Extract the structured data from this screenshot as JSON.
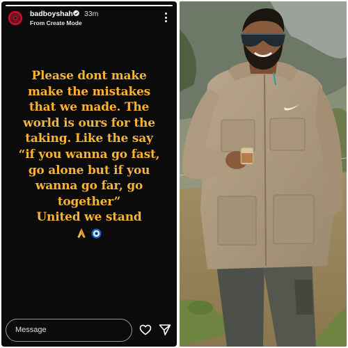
{
  "story": {
    "username": "badboyshah",
    "time_ago": "33m",
    "subtext": "From Create Mode",
    "progress": 1.0,
    "text_lines": [
      "Please dont make",
      "make the mistakes",
      "that we made. The",
      "world is ours for the",
      "taking. Like the say",
      "“if you wanna go fast,",
      "go alone but if you",
      "wanna go far, go",
      "together”",
      "United we stand"
    ],
    "emojis": [
      "folded-hands",
      "nazar-amulet"
    ],
    "text_color": "#f6b335",
    "background_color": "#0b0b0b",
    "reply_placeholder": "Message",
    "icons": {
      "more": "more-vertical-icon",
      "verified": "verified-badge-icon",
      "like": "heart-icon",
      "share": "send-icon"
    }
  },
  "photo": {
    "icons": [
      "nike-logo"
    ]
  }
}
